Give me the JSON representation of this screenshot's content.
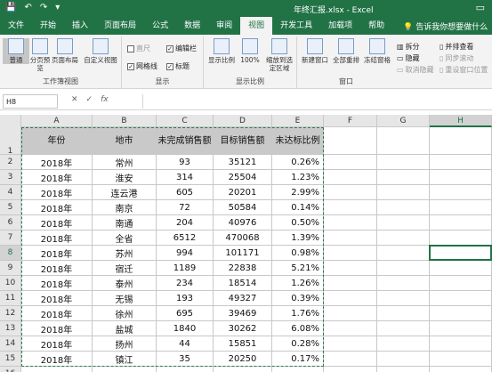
{
  "window": {
    "title": "年终汇报.xlsx - Excel"
  },
  "qat": {
    "save": "💾",
    "undo": "↶",
    "redo": "↷",
    "more": "▾"
  },
  "tabs": [
    "文件",
    "开始",
    "插入",
    "页面布局",
    "公式",
    "数据",
    "审阅",
    "视图",
    "开发工具",
    "加载项",
    "帮助"
  ],
  "active_tab": "视图",
  "tell_me": "告诉我你想要做什么",
  "ribbon": {
    "groups": {
      "workbook_views": "工作簿视图",
      "show": "显示",
      "zoom": "显示比例",
      "window": "窗口"
    },
    "buttons": {
      "normal": "普通",
      "page_break": "分页预览",
      "page_layout": "页面布局",
      "custom_views": "自定义视图",
      "zoom": "显示比例",
      "zoom100": "100%",
      "zoom_selection": "缩放到选定区域",
      "new_window": "新建窗口",
      "arrange_all": "全部重排",
      "freeze_panes": "冻结窗格",
      "split": "拆分",
      "hide": "隐藏",
      "unhide": "取消隐藏",
      "side_by_side": "并排查看",
      "sync_scroll": "同步滚动",
      "reset_position": "重设窗口位置"
    },
    "checkboxes": {
      "ruler": "直尺",
      "formula_bar": "编辑栏",
      "gridlines": "网格线",
      "headings": "标题"
    }
  },
  "formula_bar": {
    "name_box": "H8",
    "cancel": "✕",
    "enter": "✓",
    "fx": "fx",
    "value": ""
  },
  "columns": [
    "A",
    "B",
    "C",
    "D",
    "E",
    "F",
    "G",
    "H"
  ],
  "selected_column": "H",
  "selected_row": "8",
  "row_numbers": [
    "1",
    "2",
    "3",
    "4",
    "5",
    "6",
    "7",
    "8",
    "9",
    "10",
    "11",
    "12",
    "13",
    "14",
    "15",
    "16"
  ],
  "table": {
    "headers": [
      "年份",
      "地市",
      "未完成销售额",
      "目标销售额",
      "未达标比例"
    ],
    "rows": [
      [
        "2018年",
        "常州",
        "93",
        "35121",
        "0.26%"
      ],
      [
        "2018年",
        "淮安",
        "314",
        "25504",
        "1.23%"
      ],
      [
        "2018年",
        "连云港",
        "605",
        "20201",
        "2.99%"
      ],
      [
        "2018年",
        "南京",
        "72",
        "50584",
        "0.14%"
      ],
      [
        "2018年",
        "南通",
        "204",
        "40976",
        "0.50%"
      ],
      [
        "2018年",
        "全省",
        "6512",
        "470068",
        "1.39%"
      ],
      [
        "2018年",
        "苏州",
        "994",
        "101171",
        "0.98%"
      ],
      [
        "2018年",
        "宿迁",
        "1189",
        "22838",
        "5.21%"
      ],
      [
        "2018年",
        "泰州",
        "234",
        "18514",
        "1.26%"
      ],
      [
        "2018年",
        "无锡",
        "193",
        "49327",
        "0.39%"
      ],
      [
        "2018年",
        "徐州",
        "695",
        "39469",
        "1.76%"
      ],
      [
        "2018年",
        "盐城",
        "1840",
        "30262",
        "6.08%"
      ],
      [
        "2018年",
        "扬州",
        "44",
        "15851",
        "0.28%"
      ],
      [
        "2018年",
        "镇江",
        "35",
        "20250",
        "0.17%"
      ]
    ]
  }
}
